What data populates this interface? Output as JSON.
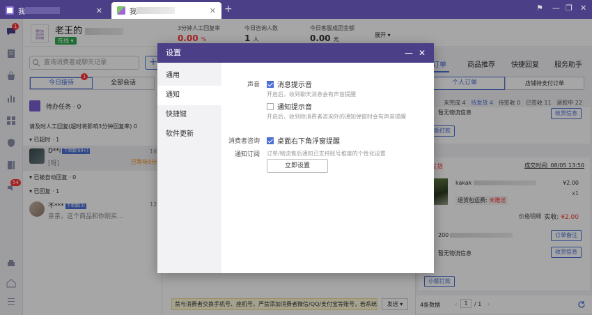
{
  "tabs": [
    {
      "label": "我"
    },
    {
      "label": "我"
    }
  ],
  "header": {
    "shop_name": "老王的",
    "shop_logo_text": "我们卖\n宝贝的\n杂货铺",
    "online_label": "在线 ▾",
    "stats": [
      {
        "label": "3分钟人工回复率",
        "value": "0.00",
        "unit": "%"
      },
      {
        "label": "今日咨询人数",
        "value": "1",
        "unit": "人"
      },
      {
        "label": "今日客服成团金额",
        "value": "0.00",
        "unit": "元"
      }
    ],
    "expand_label": "展开 ▾"
  },
  "sidebar": {
    "chat_badge": "1",
    "notice_badge": "54"
  },
  "conversations": {
    "search_placeholder": "查询消费者或聊天记录",
    "plus_label": "+",
    "tab_today": "今日接待",
    "tab_today_badge": "1",
    "tab_all": "全部会话",
    "todo_label": "待办任务 · 0",
    "reply_prompt": "请及时人工回复(超时将影响3分钟回复率) 0",
    "section_overtime": "▾ 已超时 · 1",
    "section_auto": "▾ 已被自动回复 · 0",
    "section_replied": "▾ 已回复 · 1",
    "items": [
      {
        "name": "D**i",
        "tag": "下单数(99+)",
        "msg": "[呀]",
        "time": "16:1",
        "wait": "已等待9分钟"
      },
      {
        "name": "不***",
        "tag": "下单数(3)",
        "msg": "亲亲，这个商品和你刚买...",
        "time": "12:0",
        "wait": ""
      }
    ]
  },
  "chat": {
    "notice": "禁与消费者交换手机号、座机号，严禁添加消费者微信/QQ/支付宝等账号，若系统",
    "send_label": "发送 ▾"
  },
  "right_panel": {
    "tabs": [
      "订单",
      "商品推荐",
      "快捷回复",
      "服务助手"
    ],
    "subtab_personal": "个人订单",
    "subtab_shop": "店铺待支付订单",
    "status_filters": [
      {
        "label": "未完成 4",
        "active": false
      },
      {
        "label": "待发货 4",
        "active": true
      },
      {
        "label": "待签收 0",
        "active": false
      },
      {
        "label": "已签收 11",
        "active": false
      },
      {
        "label": "退款中 22",
        "active": false
      }
    ],
    "card_top": {
      "no_logistics": "暂无物流信息",
      "logistics_btn": "收货信息",
      "pay_btn": "小额打款"
    },
    "order": {
      "status": "待发货",
      "time_label": "成交时间: 08/05 13:50",
      "product_name": "kakak",
      "price": "¥2.00",
      "qty": "x1",
      "return_fee_label": "退货包运费:",
      "return_fee_value": "未赠送",
      "price_detail": "价格明细",
      "paid_label": "实收:",
      "paid_value": "¥2.00",
      "order_id": "200",
      "remark_btn": "订单备注",
      "no_logistics": "暂无物流信息",
      "logistics_btn": "收货信息",
      "pay_btn": "小额打款"
    },
    "pagination": {
      "count": "4条数据",
      "page": "1",
      "total": "/ 1"
    }
  },
  "modal": {
    "title": "设置",
    "min_label": "—",
    "close_label": "✕",
    "nav": [
      "通用",
      "通知",
      "快捷键",
      "软件更新"
    ],
    "sound_label": "声音",
    "msg_sound": "消息提示音",
    "msg_sound_hint": "开启后，收到聊天消息会有声音提醒",
    "notify_sound": "通知提示音",
    "notify_sound_hint": "开启后，收到除消费者咨询外的通知弹窗时会有声音提醒",
    "consult_label": "消费者咨询",
    "float_remind": "桌面右下角浮窗提醒",
    "subscribe_label": "通知订阅",
    "subscribe_hint": "订单/物流售后通知已支持账号推度的个性化设置",
    "setup_btn": "立即设置"
  },
  "colors": {
    "brand": "#4b3f87",
    "accent": "#4b6fd6",
    "danger": "#ff3333"
  }
}
